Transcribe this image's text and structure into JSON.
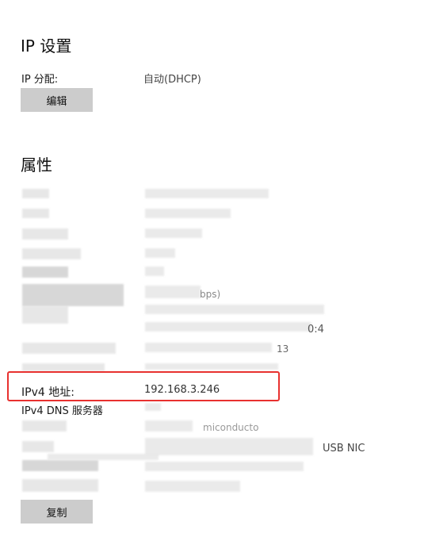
{
  "ip_settings": {
    "title": "IP 设置",
    "assignment_label": "IP 分配:",
    "assignment_value": "自动(DHCP)",
    "edit_button": "编辑"
  },
  "properties": {
    "title": "属性",
    "partial_fragments": {
      "value_fragment_1": "bps)",
      "value_fragment_2": "0:4",
      "value_fragment_3": "13",
      "value_fragment_4": "miconducto",
      "value_fragment_5": "USB NIC"
    },
    "ipv4_address_label": "IPv4 地址:",
    "ipv4_address_value": "192.168.3.246",
    "ipv4_dns_label": "IPv4 DNS 服务器",
    "copy_button": "复制"
  },
  "colors": {
    "highlight_border": "#e8312f",
    "button_bg": "#cccccc"
  }
}
